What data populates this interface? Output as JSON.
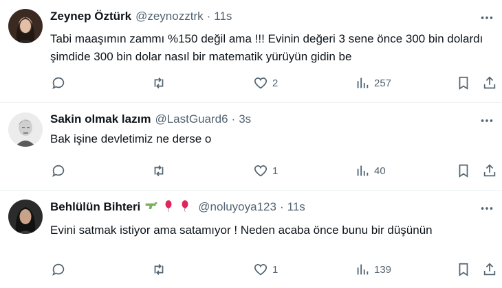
{
  "tweets": [
    {
      "name": "Zeynep Öztürk",
      "handle": "@zeynozztrk",
      "sep": "·",
      "time": "11s",
      "text": "Tabi maaşımın zammı %150 değil ama !!! Evinin değeri 3 sene önce 300 bin dolardı şimdide 300 bin dolar nasıl bir matematik yürüyün gidin be",
      "replies": "",
      "retweets": "",
      "likes": "2",
      "views": "257",
      "avatar": "woman-dark-hair-avatar"
    },
    {
      "name": "Sakin olmak lazım",
      "handle": "@LastGuard6",
      "sep": "·",
      "time": "3s",
      "text": "Bak işine devletimiz ne derse o",
      "replies": "",
      "retweets": "",
      "likes": "1",
      "views": "40",
      "avatar": "portrait-sketch-avatar"
    },
    {
      "name": "Behlülün Bihteri",
      "handle": "@noluyoya123",
      "sep": "·",
      "time": "11s",
      "emojis": [
        "water-pistol-icon",
        "balloon-icon",
        "balloon-icon"
      ],
      "text": "Evini satmak istiyor ama satamıyor ! Neden acaba önce bunu bir düşünün",
      "replies": "",
      "retweets": "",
      "likes": "1",
      "views": "139",
      "avatar": "woman-portrait-avatar"
    }
  ],
  "colors": {
    "text": "#0f1419",
    "secondary": "#536471",
    "divider": "#eff3f4",
    "balloon": "#e0245e",
    "pistol": "#78b159"
  }
}
